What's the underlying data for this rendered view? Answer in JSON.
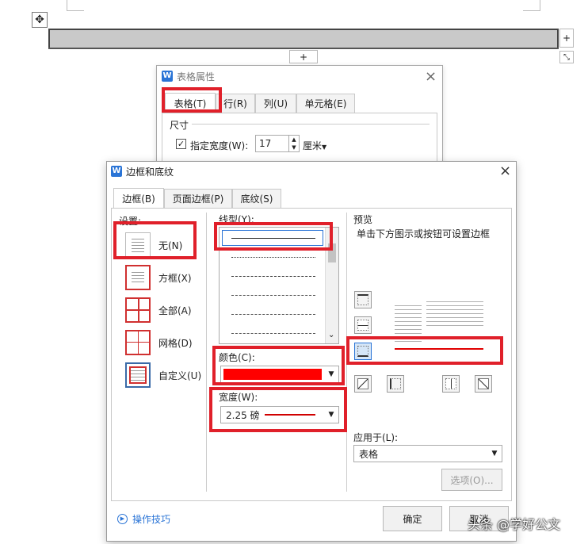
{
  "document": {
    "move_handle_icon": "move-icon",
    "add_col_label": "+",
    "add_row_label": "+",
    "resize_icon": "resize-icon"
  },
  "table_props": {
    "title": "表格属性",
    "tabs": [
      "表格(T)",
      "行(R)",
      "列(U)",
      "单元格(E)"
    ],
    "size_section": "尺寸",
    "width_label": "指定宽度(W):",
    "width_value": "17",
    "unit": "厘米"
  },
  "border_dialog": {
    "title": "边框和底纹",
    "tabs": [
      "边框(B)",
      "页面边框(P)",
      "底纹(S)"
    ],
    "settings_label": "设置:",
    "settings": [
      "无(N)",
      "方框(X)",
      "全部(A)",
      "网格(D)",
      "自定义(U)"
    ],
    "style_label": "线型(Y):",
    "color_label": "颜色(C):",
    "color_value": "#ff0000",
    "width_label": "宽度(W):",
    "width_value": "2.25 磅",
    "preview_label": "预览",
    "preview_hint": "单击下方图示或按钮可设置边框",
    "apply_label": "应用于(L):",
    "apply_value": "表格",
    "options_button": "选项(O)...",
    "tips": "操作技巧",
    "ok": "确定",
    "cancel": "取消"
  },
  "watermark": "头条 @学好公文",
  "colors": {
    "highlight": "#e0202a",
    "accent": "#2a74d6",
    "line_red": "#e00000"
  }
}
